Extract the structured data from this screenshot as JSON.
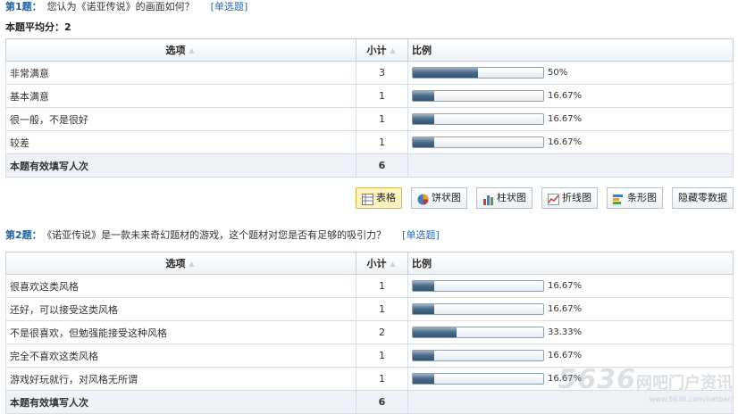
{
  "q1": {
    "num": "第1题：",
    "text": "您认为《诺亚传说》的画面如何？",
    "type": "[单选题]",
    "avg": "本题平均分：2",
    "headers": {
      "option": "选项",
      "count": "小计",
      "ratio": "比例"
    },
    "rows": [
      {
        "option": "非常满意",
        "count": "3",
        "pct": "50%",
        "frac": 0.5
      },
      {
        "option": "基本满意",
        "count": "1",
        "pct": "16.67%",
        "frac": 0.1667
      },
      {
        "option": "很一般，不是很好",
        "count": "1",
        "pct": "16.67%",
        "frac": 0.1667
      },
      {
        "option": "较差",
        "count": "1",
        "pct": "16.67%",
        "frac": 0.1667
      }
    ],
    "total_label": "本题有效填写人次",
    "total": "6"
  },
  "toolbar": {
    "table": "表格",
    "pie": "饼状图",
    "bar": "柱状图",
    "line": "折线图",
    "hbar": "条形图",
    "hide": "隐藏零数据"
  },
  "q2": {
    "num": "第2题：",
    "text": "《诺亚传说》是一款未来奇幻题材的游戏，这个题材对您是否有足够的吸引力？",
    "type": "[单选题]",
    "headers": {
      "option": "选项",
      "count": "小计",
      "ratio": "比例"
    },
    "rows": [
      {
        "option": "很喜欢这类风格",
        "count": "1",
        "pct": "16.67%",
        "frac": 0.1667
      },
      {
        "option": "还好，可以接受这类风格",
        "count": "1",
        "pct": "16.67%",
        "frac": 0.1667
      },
      {
        "option": "不是很喜欢，但勉强能接受这种风格",
        "count": "2",
        "pct": "33.33%",
        "frac": 0.3333
      },
      {
        "option": "完全不喜欢这类风格",
        "count": "1",
        "pct": "16.67%",
        "frac": 0.1667
      },
      {
        "option": "游戏好玩就行，对风格无所谓",
        "count": "1",
        "pct": "16.67%",
        "frac": 0.1667
      }
    ],
    "total_label": "本题有效填写人次",
    "total": "6"
  },
  "watermark": {
    "big": "5636",
    "cn": "网吧门户资讯",
    "url": "www.5636.com/netbar/"
  },
  "colors": {
    "bar_fill": "#4d6d8c",
    "title_blue": "#1f5fa0",
    "active_btn": "#fff3bf"
  }
}
